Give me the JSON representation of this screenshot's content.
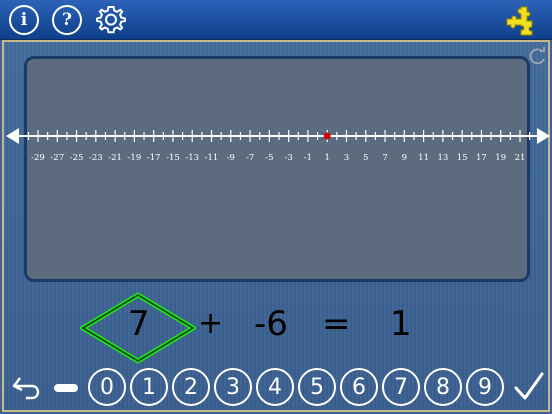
{
  "toolbar": {
    "info_label": "i",
    "help_label": "?",
    "settings_icon": "gear-icon",
    "puzzle_icon": "puzzle-icon"
  },
  "number_line": {
    "min": -30,
    "max": 22,
    "labeled_ticks": [
      -29,
      -27,
      -25,
      -23,
      -21,
      -19,
      -17,
      -15,
      -13,
      -11,
      -9,
      -7,
      -5,
      -3,
      -1,
      1,
      3,
      5,
      7,
      9,
      11,
      13,
      15,
      17,
      19,
      21
    ],
    "marked_point": 1
  },
  "equation": {
    "operand1": "7",
    "operator": "+",
    "operand2": "-6",
    "equals": "=",
    "result": "1"
  },
  "keypad": {
    "minus_icon": "minus-icon",
    "digits": [
      "0",
      "1",
      "2",
      "3",
      "4",
      "5",
      "6",
      "7",
      "8",
      "9"
    ],
    "undo_icon": "undo-icon",
    "check_icon": "check-icon"
  },
  "colors": {
    "topbar": "#1a4fa0",
    "background": "#3d6496",
    "panel": "#5d6b7e",
    "highlight": "#22dd22",
    "point": "#cc0000",
    "puzzle": "#f0e020"
  }
}
